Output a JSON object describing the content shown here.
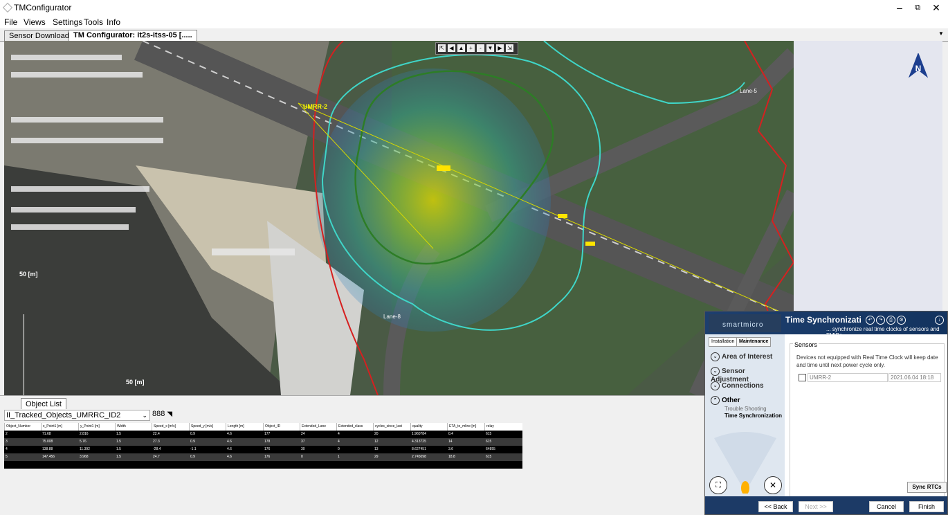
{
  "window": {
    "title": "TMConfigurator",
    "minimize": "–",
    "restore": "⧉",
    "close": "✕"
  },
  "menu": [
    "File",
    "Views",
    "Settings",
    "Tools",
    "Info"
  ],
  "tabs": {
    "download": "Sensor Download",
    "configurator": "TM Configurator: it2s-itss-05 [....."
  },
  "map": {
    "nav_buttons": [
      "⇱",
      "◀",
      "▲",
      "+",
      "-",
      "▼",
      "▶",
      "⇲"
    ],
    "labels": {
      "umrr": "UMRR-2",
      "lane5": "Lane-5",
      "lane8": "Lane-8"
    },
    "scale_v": "50 [m]",
    "scale_h": "50 [m]",
    "compass": "N"
  },
  "object_list": {
    "tab": "Object List",
    "dropdown": "II_Tracked_Objects_UMRRC_ID2",
    "count": "888",
    "columns": [
      "Object_Number",
      "x_Point1 [m]",
      "y_Point1 [m]",
      "Width",
      "Speed_x [m/s]",
      "Speed_y [m/s]",
      "Length [m]",
      "Object_ID",
      "Extended_Lane",
      "Extended_class",
      "cycles_since_last",
      "quality",
      "ETA_to_mline [m]",
      "relay"
    ],
    "rows": [
      [
        "2",
        "71.68",
        "2.816",
        "1.5",
        "22.4",
        "0.9",
        "4.6",
        "177",
        "24",
        "4",
        "20",
        "1.960784",
        "0.4",
        "615"
      ],
      [
        "3",
        "75.008",
        "5.76",
        "1.5",
        "27.3",
        "0.9",
        "4.6",
        "178",
        "37",
        "4",
        "12",
        "4.313725",
        "14",
        "615"
      ],
      [
        "4",
        "138.88",
        "11.392",
        "1.5",
        "-28.4",
        "-1.1",
        "4.6",
        "176",
        "30",
        "0",
        "13",
        "8.627451",
        "3.6",
        "64855"
      ],
      [
        "5",
        "147.456",
        "3.968",
        "1.5",
        "24.7",
        "0.9",
        "4.6",
        "176",
        "0",
        "1",
        "29",
        "2.745098",
        "18.8",
        "615"
      ]
    ]
  },
  "smartmicro": {
    "logo": "smartmicro",
    "title": "Time Synchronizati",
    "subtitle": "... synchronize real time clocks of sensors and TMIBs",
    "nav_tabs": [
      "Installation",
      "Maintenance"
    ],
    "nav_items": [
      "Area of Interest",
      "Sensor Adjustment",
      "Connections",
      "Other"
    ],
    "sub_items": [
      "Trouble Shooting",
      "Time Synchronization"
    ],
    "sensors_label": "Sensors",
    "sensors_text": "Devices not equipped with Real Time Clock will keep date and time until next power cycle only.",
    "sensor_name": "UMRR-2",
    "sensor_time": "2021.06.04 18:18",
    "sync_button": "Sync RTCs",
    "footer": {
      "back": "<< Back",
      "next": "Next >>",
      "cancel": "Cancel",
      "finish": "Finish"
    }
  }
}
